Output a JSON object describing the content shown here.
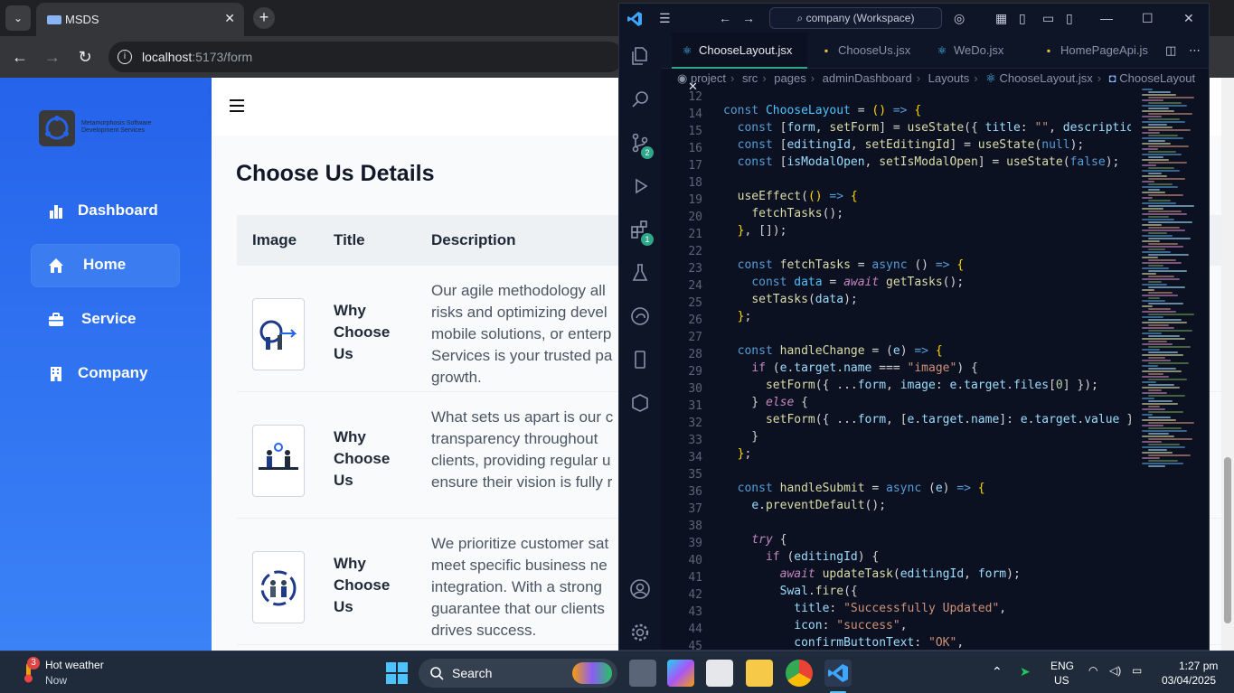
{
  "browser": {
    "tab_title": "MSDS",
    "tab_close": "✕",
    "new_tab": "+",
    "url_host": "localhost",
    "url_path": ":5173/form"
  },
  "app": {
    "logo_text": "Metamorphosis Software Development Services",
    "nav": [
      {
        "label": "Dashboard",
        "icon": "bar-chart-icon"
      },
      {
        "label": "Home",
        "icon": "home-icon"
      },
      {
        "label": "Service",
        "icon": "briefcase-icon"
      },
      {
        "label": "Company",
        "icon": "building-icon"
      }
    ],
    "page_title": "Choose Us Details",
    "table": {
      "headers": [
        "Image",
        "Title",
        "Description"
      ],
      "rows": [
        {
          "title": "Why Choose Us",
          "desc_lines": [
            "Our agile methodology all",
            "risks and optimizing devel",
            "mobile solutions, or enterp",
            "Services is your trusted pa",
            "growth."
          ]
        },
        {
          "title": "Why Choose Us",
          "desc_lines": [
            "What sets us apart is our c",
            "transparency throughout",
            "clients, providing regular u",
            "ensure their vision is fully r"
          ]
        },
        {
          "title": "Why Choose Us",
          "desc_lines": [
            "We prioritize customer sat",
            "meet specific business ne",
            "integration. With a strong",
            "guarantee that our clients",
            "drives success."
          ]
        }
      ]
    }
  },
  "vscode": {
    "search": "company (Workspace)",
    "tabs": [
      {
        "label": "ChooseLayout.jsx",
        "kind": "react",
        "active": true
      },
      {
        "label": "ChooseUs.jsx",
        "kind": "js",
        "active": false
      },
      {
        "label": "WeDo.jsx",
        "kind": "react",
        "active": false
      },
      {
        "label": "HomePageApi.js",
        "kind": "js",
        "active": false
      }
    ],
    "breadcrumbs": [
      "project",
      "src",
      "pages",
      "adminDashboard",
      "Layouts",
      "ChooseLayout.jsx",
      "ChooseLayout"
    ],
    "badges": {
      "source_control": "2",
      "extensions": "1"
    },
    "line_numbers": [
      "12",
      "14",
      "15",
      "16",
      "17",
      "18",
      "19",
      "20",
      "21",
      "22",
      "23",
      "24",
      "25",
      "26",
      "27",
      "28",
      "29",
      "30",
      "31",
      "32",
      "33",
      "34",
      "35",
      "36",
      "37",
      "38",
      "39",
      "40",
      "41",
      "42",
      "43",
      "44",
      "45"
    ]
  },
  "taskbar": {
    "weather_title": "Hot weather",
    "weather_sub": "Now",
    "weather_badge": "3",
    "search_label": "Search",
    "lang": "ENG",
    "region": "US",
    "time": "1:27 pm",
    "date": "03/04/2025"
  }
}
